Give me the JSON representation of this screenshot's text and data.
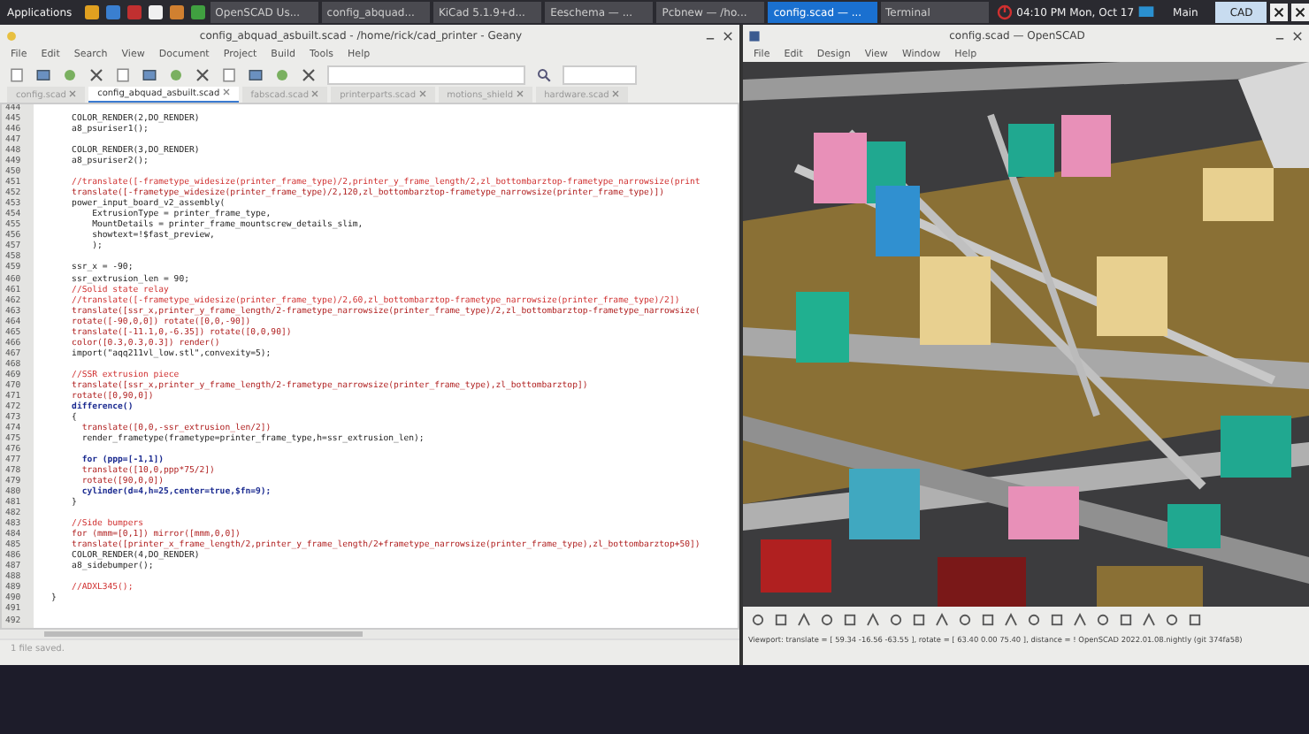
{
  "taskbar": {
    "menu": "Applications",
    "windows": [
      {
        "label": "OpenSCAD Us...",
        "selected": false
      },
      {
        "label": "config_abquad...",
        "selected": false
      },
      {
        "label": "KiCad 5.1.9+d...",
        "selected": false
      },
      {
        "label": "Eeschema — ...",
        "selected": false
      },
      {
        "label": "Pcbnew — /ho...",
        "selected": false
      },
      {
        "label": "config.scad — ...",
        "selected": true
      },
      {
        "label": "Terminal",
        "selected": false
      }
    ],
    "clock": "04:10 PM",
    "date": "Mon, Oct 17",
    "workspaces": [
      {
        "label": "Main",
        "selected": false
      },
      {
        "label": "CAD",
        "selected": true
      }
    ]
  },
  "editor": {
    "title": "config_abquad_asbuilt.scad - /home/rick/cad_printer - Geany",
    "menu": [
      "File",
      "Edit",
      "Search",
      "View",
      "Document",
      "Project",
      "Build",
      "Tools",
      "Help"
    ],
    "tabs": [
      {
        "label": "config.scad",
        "selected": false
      },
      {
        "label": "config_abquad_asbuilt.scad",
        "selected": true
      },
      {
        "label": "fabscad.scad",
        "selected": false
      },
      {
        "label": "printerparts.scad",
        "selected": false
      },
      {
        "label": "motions_shield",
        "selected": false
      },
      {
        "label": "hardware.scad",
        "selected": false
      }
    ],
    "lines": [
      {
        "number": "444"
      },
      {
        "number": "445",
        "kind": "plain",
        "text": "    COLOR_RENDER(2,DO_RENDER)"
      },
      {
        "number": "446",
        "kind": "plain",
        "text": "    a8_psuriser1();"
      },
      {
        "number": "447"
      },
      {
        "number": "448",
        "kind": "plain",
        "text": "    COLOR_RENDER(3,DO_RENDER)"
      },
      {
        "number": "449",
        "kind": "plain",
        "text": "    a8_psuriser2();"
      },
      {
        "number": "450"
      },
      {
        "number": "451",
        "kind": "comment",
        "text": "    //translate([-frametype_widesize(printer_frame_type)/2,printer_y_frame_length/2,zl_bottombarztop-frametype_narrowsize(print"
      },
      {
        "number": "452",
        "kind": "call",
        "text": "    translate([-frametype_widesize(printer_frame_type)/2,120,zl_bottombarztop-frametype_narrowsize(printer_frame_type)])"
      },
      {
        "number": "453",
        "kind": "plain",
        "text": "    power_input_board_v2_assembly("
      },
      {
        "number": "454",
        "kind": "plain",
        "text": "        ExtrusionType = printer_frame_type,"
      },
      {
        "number": "455",
        "kind": "plain",
        "text": "        MountDetails = printer_frame_mountscrew_details_slim,"
      },
      {
        "number": "456",
        "kind": "plain",
        "text": "        showtext=!$fast_preview,"
      },
      {
        "number": "457",
        "kind": "plain",
        "text": "        );"
      },
      {
        "number": "458"
      },
      {
        "number": "459",
        "kind": "plain",
        "text": "    ssr_x = -90;"
      },
      {
        "number": "460",
        "kind": "plain",
        "text": "    ssr_extrusion_len = 90;"
      },
      {
        "number": "461",
        "kind": "comment",
        "text": "    //Solid state relay"
      },
      {
        "number": "462",
        "kind": "comment",
        "text": "    //translate([-frametype_widesize(printer_frame_type)/2,60,zl_bottombarztop-frametype_narrowsize(printer_frame_type)/2])"
      },
      {
        "number": "463",
        "kind": "call",
        "text": "    translate([ssr_x,printer_y_frame_length/2-frametype_narrowsize(printer_frame_type)/2,zl_bottombarztop-frametype_narrowsize("
      },
      {
        "number": "464",
        "kind": "call",
        "text": "    rotate([-90,0,0]) rotate([0,0,-90])"
      },
      {
        "number": "465",
        "kind": "call",
        "text": "    translate([-11.1,0,-6.35]) rotate([0,0,90])"
      },
      {
        "number": "466",
        "kind": "call",
        "text": "    color([0.3,0.3,0.3]) render()"
      },
      {
        "number": "467",
        "kind": "plain",
        "text": "    import(\"aqq211vl_low.stl\",convexity=5);"
      },
      {
        "number": "468"
      },
      {
        "number": "469",
        "kind": "comment",
        "text": "    //SSR extrusion piece"
      },
      {
        "number": "470",
        "kind": "call",
        "text": "    translate([ssr_x,printer_y_frame_length/2-frametype_narrowsize(printer_frame_type),zl_bottombarztop])"
      },
      {
        "number": "471",
        "kind": "call",
        "text": "    rotate([0,90,0])"
      },
      {
        "number": "472",
        "kind": "keyword",
        "text": "    difference()"
      },
      {
        "number": "473",
        "kind": "plain",
        "text": "    {"
      },
      {
        "number": "474",
        "kind": "call",
        "text": "      translate([0,0,-ssr_extrusion_len/2])"
      },
      {
        "number": "475",
        "kind": "plain",
        "text": "      render_frametype(frametype=printer_frame_type,h=ssr_extrusion_len);"
      },
      {
        "number": "476"
      },
      {
        "number": "477",
        "kind": "keyword",
        "text": "      for (ppp=[-1,1])"
      },
      {
        "number": "478",
        "kind": "call",
        "text": "      translate([10,0,ppp*75/2])"
      },
      {
        "number": "479",
        "kind": "call",
        "text": "      rotate([90,0,0])"
      },
      {
        "number": "480",
        "kind": "keyword",
        "text": "      cylinder(d=4,h=25,center=true,$fn=9);"
      },
      {
        "number": "481",
        "kind": "plain",
        "text": "    }"
      },
      {
        "number": "482"
      },
      {
        "number": "483",
        "kind": "comment",
        "text": "    //Side bumpers"
      },
      {
        "number": "484",
        "kind": "call",
        "text": "    for (mmm=[0,1]) mirror([mmm,0,0])"
      },
      {
        "number": "485",
        "kind": "call",
        "text": "    translate([printer_x_frame_length/2,printer_y_frame_length/2+frametype_narrowsize(printer_frame_type),zl_bottombarztop+50])"
      },
      {
        "number": "486",
        "kind": "plain",
        "text": "    COLOR_RENDER(4,DO_RENDER)"
      },
      {
        "number": "487",
        "kind": "plain",
        "text": "    a8_sidebumper();"
      },
      {
        "number": "488"
      },
      {
        "number": "489",
        "kind": "comment",
        "text": "    //ADXL345();"
      },
      {
        "number": "490",
        "kind": "plain",
        "text": "}"
      },
      {
        "number": "491"
      },
      {
        "number": "492"
      }
    ],
    "status": "1 file saved."
  },
  "viewer": {
    "title": "config.scad — OpenSCAD",
    "menu": [
      "File",
      "Edit",
      "Design",
      "View",
      "Window",
      "Help"
    ],
    "status": "Viewport: translate = [ 59.34 -16.56 -63.55 ], rotate = [ 63.40 0.00 75.40 ], distance = ! OpenSCAD 2022.01.08.nightly (git 374fa58)"
  }
}
